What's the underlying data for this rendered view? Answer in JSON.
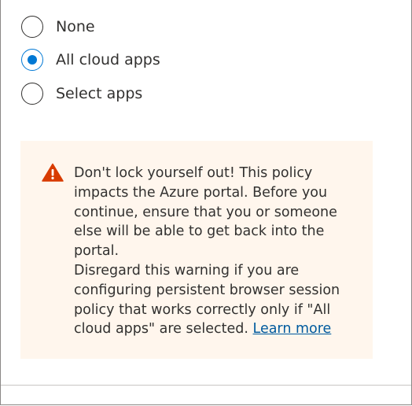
{
  "radio_group": {
    "options": [
      {
        "label": "None",
        "checked": false
      },
      {
        "label": "All cloud apps",
        "checked": true
      },
      {
        "label": "Select apps",
        "checked": false
      }
    ]
  },
  "warning": {
    "icon": "warning-triangle-icon",
    "icon_color": "#d83b01",
    "background": "#fff6ed",
    "paragraph1": "Don't lock yourself out! This policy impacts the Azure portal. Before you continue, ensure that you or someone else will be able to get back into the portal.",
    "paragraph2": "Disregard this warning if you are configuring persistent browser session policy that works correctly only if \"All cloud apps\" are selected.",
    "link_text": "Learn more"
  },
  "colors": {
    "accent": "#0078d4",
    "text": "#323130",
    "link": "#005a9e"
  }
}
